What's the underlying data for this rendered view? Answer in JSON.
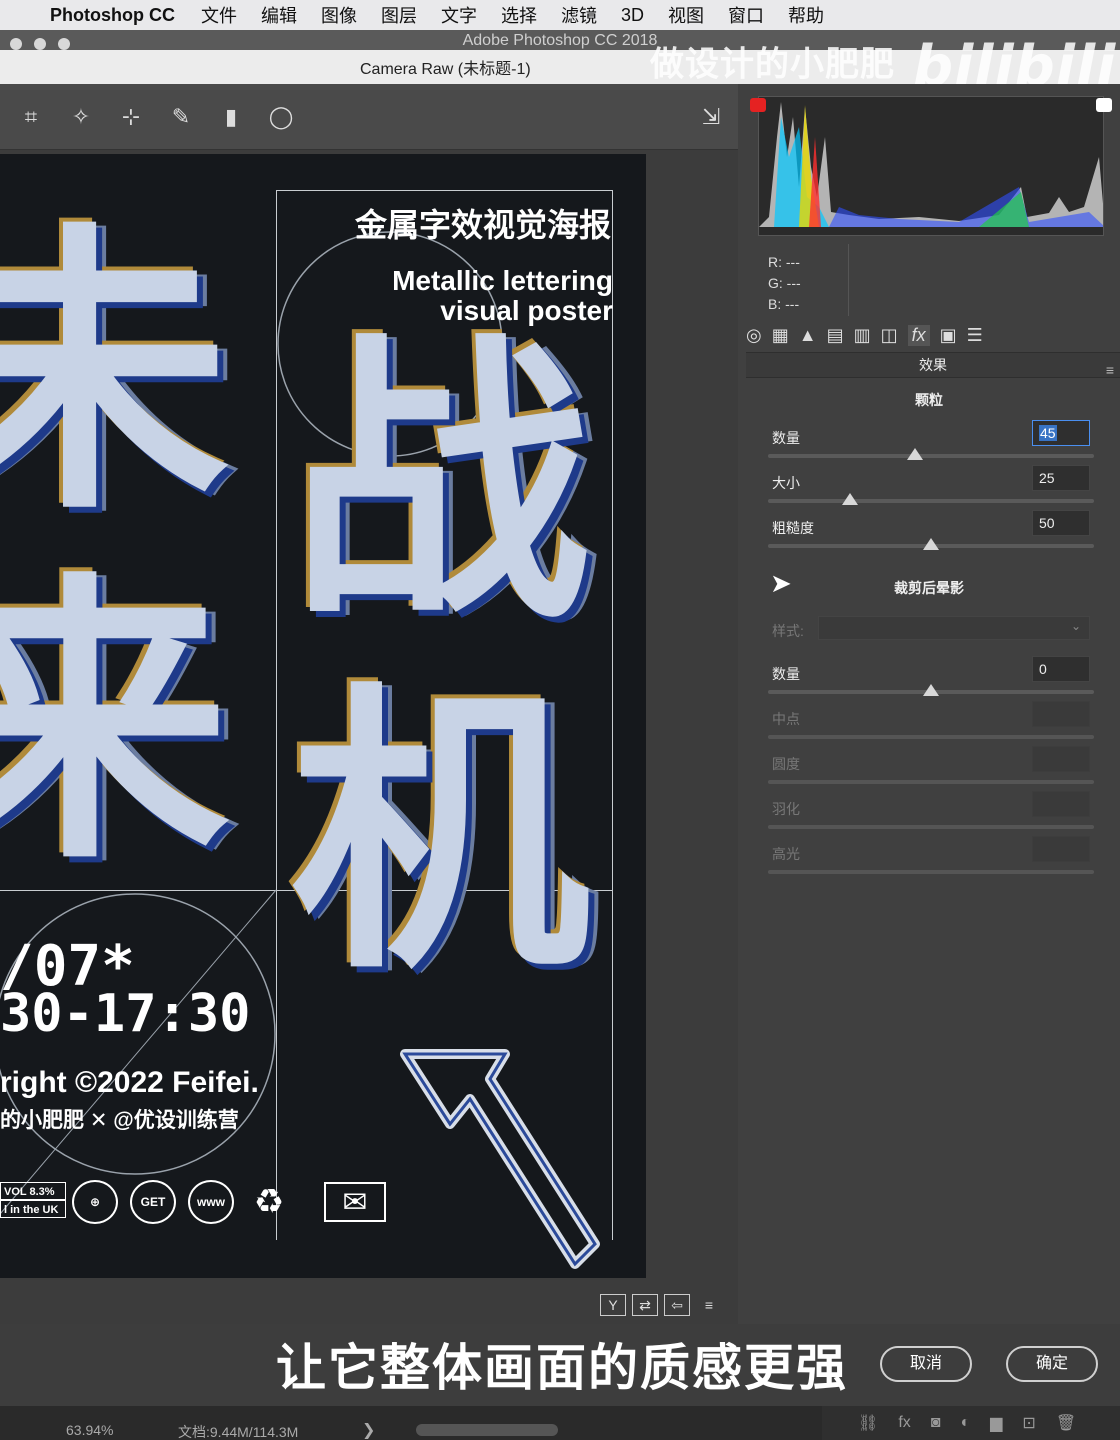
{
  "menubar": {
    "app_name": "Photoshop CC",
    "items": [
      "文件",
      "编辑",
      "图像",
      "图层",
      "文字",
      "选择",
      "滤镜",
      "3D",
      "视图",
      "窗口",
      "帮助"
    ]
  },
  "ps_window_title": "Adobe Photoshop CC 2018",
  "camera_raw_title": "Camera Raw (未标题-1)",
  "watermark": {
    "text": "做设计的小肥肥",
    "logo": "bilibili"
  },
  "toolbar_icons": [
    "transform-icon",
    "spot-removal-icon",
    "red-eye-icon",
    "adjustment-brush-icon",
    "graduated-filter-icon",
    "radial-filter-icon",
    "open-preferences-icon"
  ],
  "poster": {
    "title_cn": "金属字效视觉海报",
    "title_en_line1": "Metallic lettering",
    "title_en_line2": "visual poster",
    "big_chars": [
      "未",
      "来",
      "战",
      "机"
    ],
    "date_line1": "/07*",
    "date_line2": "30-17:30",
    "copyright": "right ©2022 Feifei.",
    "credit": "的小肥肥 ✕ @优设训练营",
    "badge1": "VOL 8.3%",
    "badge2": "l in the UK",
    "icons": [
      "⊕",
      "GET",
      "www",
      "♻",
      "✉"
    ]
  },
  "view_buttons": [
    "Y",
    "⇄",
    "⇦",
    "≡"
  ],
  "rgb_readout": {
    "r": "R:  ---",
    "g": "G:  ---",
    "b": "B:  ---"
  },
  "panel_tabs": [
    "◎",
    "▦",
    "▲",
    "▤",
    "▥",
    "◫",
    "fx",
    "▣",
    "☰"
  ],
  "panel_title": "效果",
  "grain": {
    "title": "颗粒",
    "amount_label": "数量",
    "amount_value": "45",
    "amount_level": 0.45,
    "size_label": "大小",
    "size_value": "25",
    "size_level": 0.25,
    "roughness_label": "粗糙度",
    "roughness_value": "50",
    "roughness_level": 0.5
  },
  "vignette": {
    "title": "裁剪后晕影",
    "style_label": "样式:",
    "amount_label": "数量",
    "amount_value": "0",
    "amount_level": 0.5,
    "midpoint_label": "中点",
    "roundness_label": "圆度",
    "feather_label": "羽化",
    "highlights_label": "高光"
  },
  "subtitle": "让它整体画面的质感更强",
  "buttons": {
    "cancel": "取消",
    "ok": "确定"
  },
  "status": {
    "zoom": "63.94%",
    "doc": "文档:9.44M/114.3M",
    "arrow": "❯"
  },
  "dock_icons": [
    "⛓",
    "fx",
    "◙",
    "◐",
    "▆",
    "⊡",
    "🗑"
  ],
  "colors": {
    "accent": "#4a8ff0",
    "panel": "#404040",
    "canvas": "#15181c"
  }
}
